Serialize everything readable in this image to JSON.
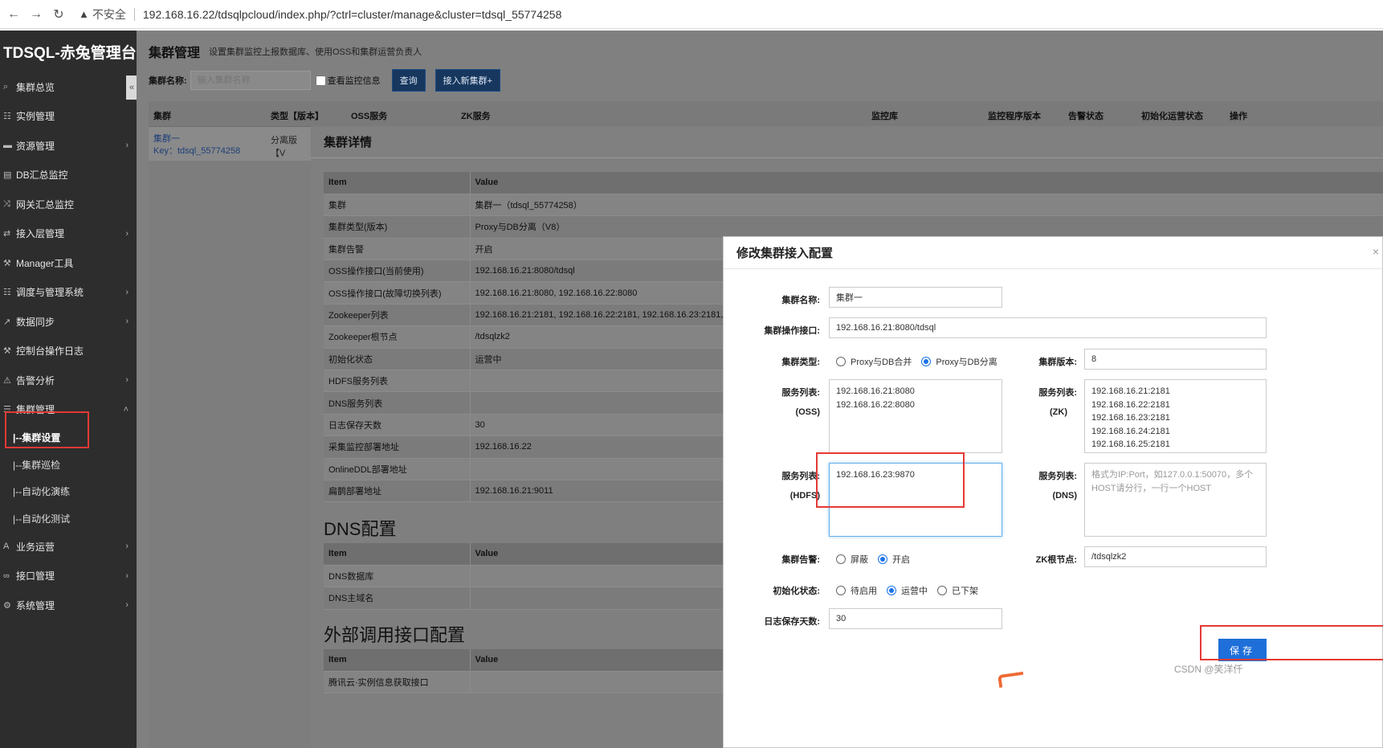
{
  "browser": {
    "security_text": "不安全",
    "url": "192.168.16.22/tdsqlpcloud/index.php/?ctrl=cluster/manage&cluster=tdsql_55774258"
  },
  "sidebar": {
    "brand": "TDSQL-赤兔管理台",
    "items": [
      {
        "label": "集群总览",
        "icon": "search-icon",
        "arrow": false
      },
      {
        "label": "实例管理",
        "icon": "grid-icon",
        "arrow": false
      },
      {
        "label": "资源管理",
        "icon": "server-icon",
        "arrow": true
      },
      {
        "label": "DB汇总监控",
        "icon": "monitor-icon",
        "arrow": false
      },
      {
        "label": "网关汇总监控",
        "icon": "shuffle-icon",
        "arrow": false
      },
      {
        "label": "接入层管理",
        "icon": "sync-icon",
        "arrow": true
      },
      {
        "label": "Manager工具",
        "icon": "tool-icon",
        "arrow": false
      },
      {
        "label": "调度与管理系统",
        "icon": "grid-icon",
        "arrow": true
      },
      {
        "label": "数据同步",
        "icon": "chart-icon",
        "arrow": true
      },
      {
        "label": "控制台操作日志",
        "icon": "wrench-icon",
        "arrow": false
      },
      {
        "label": "告警分析",
        "icon": "warning-icon",
        "arrow": true
      },
      {
        "label": "集群管理",
        "icon": "list-icon",
        "arrow": "up"
      }
    ],
    "sub_items": [
      "|--集群设置",
      "|--集群巡检",
      "|--自动化演练",
      "|--自动化测试"
    ],
    "bottom_items": [
      {
        "label": "业务运营",
        "icon": "font-icon",
        "arrow": true
      },
      {
        "label": "接口管理",
        "icon": "link-icon",
        "arrow": true
      },
      {
        "label": "系统管理",
        "icon": "gear-icon",
        "arrow": true
      }
    ]
  },
  "main": {
    "title": "集群管理",
    "subtitle": "设置集群监控上报数据库、使用OSS和集群运营负责人",
    "filter_label": "集群名称:",
    "filter_placeholder": "输入集群名称",
    "check_label": "查看监控信息",
    "query_btn": "查询",
    "add_btn": "接入新集群+",
    "columns": [
      "集群",
      "类型【版本】",
      "OSS服务",
      "ZK服务",
      "监控库",
      "监控程序版本",
      "告警状态",
      "初始化运营状态",
      "操作"
    ],
    "row": {
      "name": "集群一",
      "key": "Key：tdsql_55774258",
      "type": "分离版【V"
    }
  },
  "detail": {
    "title": "集群详情",
    "header": [
      "Item",
      "Value"
    ],
    "rows": [
      [
        "集群",
        "集群一（tdsql_55774258）"
      ],
      [
        "集群类型(版本)",
        "Proxy与DB分离（V8）"
      ],
      [
        "集群告警",
        "开启"
      ],
      [
        "OSS操作接口(当前使用)",
        "192.168.16.21:8080/tdsql"
      ],
      [
        "OSS操作接口(故障切换列表)",
        "192.168.16.21:8080, 192.168.16.22:8080"
      ],
      [
        "Zookeeper列表",
        "192.168.16.21:2181, 192.168.16.22:2181, 192.168.16.23:2181,"
      ],
      [
        "Zookeeper根节点",
        "/tdsqlzk2"
      ],
      [
        "初始化状态",
        "运营中"
      ],
      [
        "HDFS服务列表",
        ""
      ],
      [
        "DNS服务列表",
        ""
      ],
      [
        "日志保存天数",
        "30"
      ],
      [
        "采集监控部署地址",
        "192.168.16.22"
      ],
      [
        "OnlineDDL部署地址",
        ""
      ],
      [
        "扁鹊部署地址",
        "192.168.16.21:9011"
      ]
    ],
    "dns_title": "DNS配置",
    "dns_rows": [
      [
        "DNS数据库",
        ""
      ],
      [
        "DNS主域名",
        ""
      ]
    ],
    "ext_title": "外部调用接口配置",
    "ext_rows": [
      [
        "腾讯云·实例信息获取接口",
        ""
      ]
    ]
  },
  "edit": {
    "title": "修改集群接入配置",
    "name_label": "集群名称:",
    "name_value": "集群一",
    "api_label": "集群操作接口:",
    "api_value": "192.168.16.21:8080/tdsql",
    "type_label": "集群类型:",
    "type_options": [
      "Proxy与DB合并",
      "Proxy与DB分离"
    ],
    "version_label": "集群版本:",
    "version_value": "8",
    "oss_label": "服务列表:",
    "oss_sub": "(OSS)",
    "oss_value": "192.168.16.21:8080\n192.168.16.22:8080",
    "zk_label": "服务列表:",
    "zk_sub": "(ZK)",
    "zk_value": "192.168.16.21:2181\n192.168.16.22:2181\n192.168.16.23:2181\n192.168.16.24:2181\n192.168.16.25:2181",
    "hdfs_label": "服务列表:",
    "hdfs_sub": "(HDFS)",
    "hdfs_value": "192.168.16.23:9870",
    "dns_label": "服务列表:",
    "dns_sub": "(DNS)",
    "dns_placeholder": "格式为IP:Port，如127.0.0.1:50070，多个HOST请分行，一行一个HOST",
    "alarm_label": "集群告警:",
    "alarm_options": [
      "屏蔽",
      "开启"
    ],
    "zkroot_label": "ZK根节点:",
    "zkroot_value": "/tdsqlzk2",
    "init_label": "初始化状态:",
    "init_options": [
      "待启用",
      "运营中",
      "已下架"
    ],
    "log_label": "日志保存天数:",
    "log_value": "30",
    "save_btn": "保存",
    "close": "×"
  },
  "watermark": "CSDN @笑洋仟",
  "colors": {
    "highlight_red": "#e53935",
    "primary_blue": "#1e6fd9",
    "sidebar_bg": "#2d2d2d"
  }
}
